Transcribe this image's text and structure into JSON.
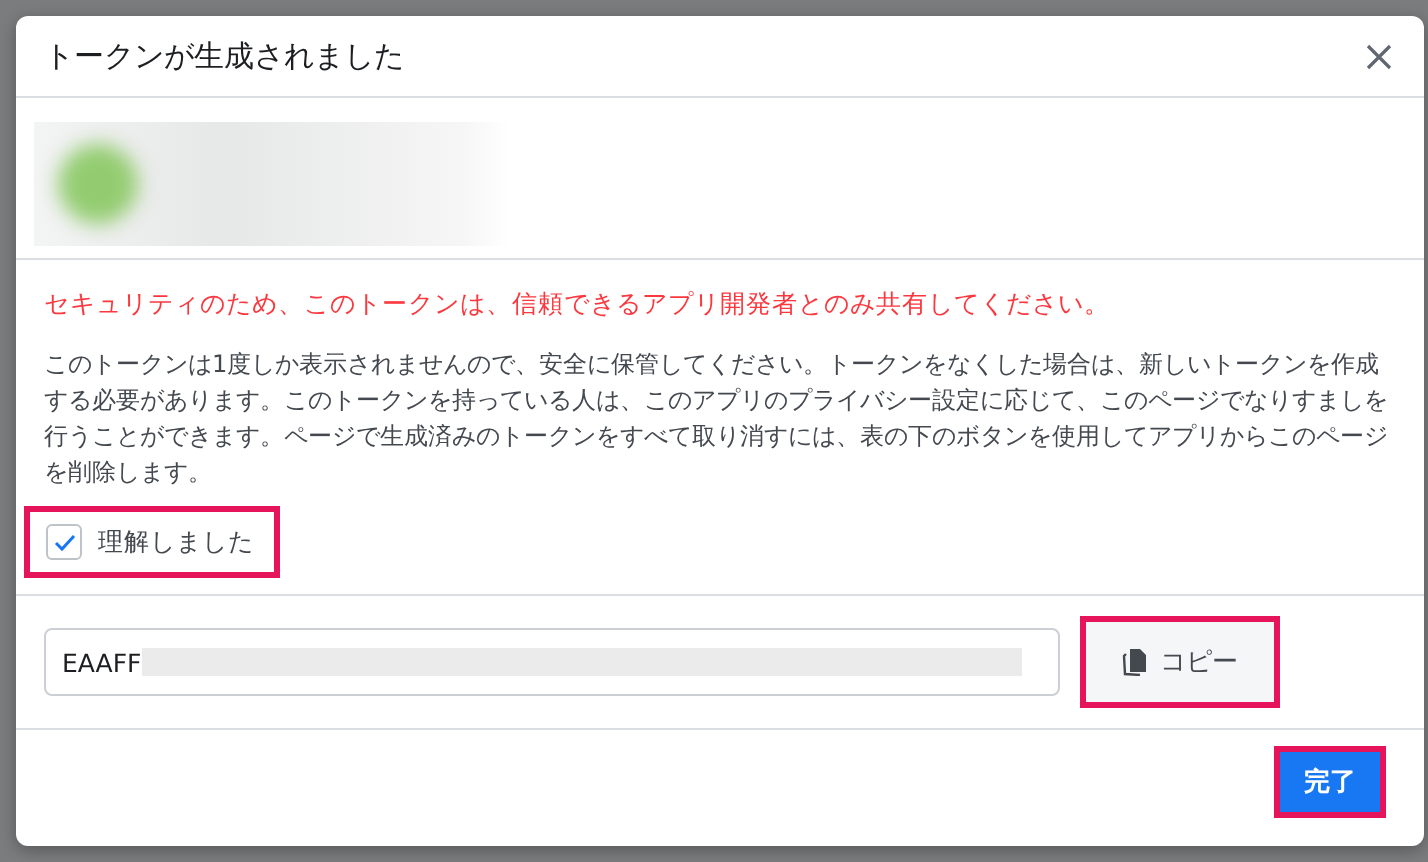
{
  "dialog": {
    "title": "トークンが生成されました",
    "warning": "セキュリティのため、このトークンは、信頼できるアプリ開発者とのみ共有してください。",
    "description": "このトークンは1度しか表示されませんので、安全に保管してください。トークンをなくした場合は、新しいトークンを作成する必要があります。このトークンを持っている人は、このアプリのプライバシー設定に応じて、このページでなりすましを行うことができます。ページで生成済みのトークンをすべて取り消すには、表の下のボタンを使用してアプリからこのページを削除します。",
    "acknowledge": {
      "label": "理解しました",
      "checked": true
    },
    "token": {
      "value": "EAAFF"
    },
    "copy_button": "コピー",
    "done_button": "完了"
  }
}
